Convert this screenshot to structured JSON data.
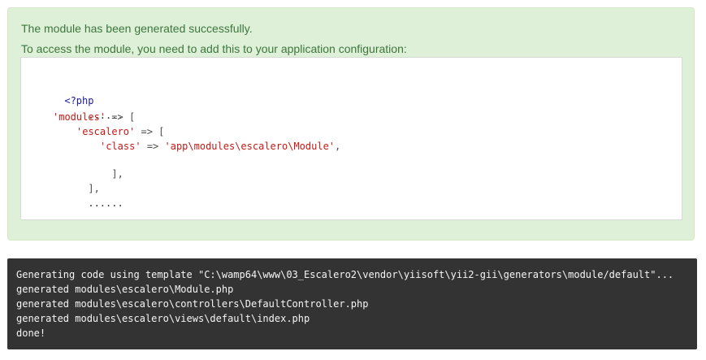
{
  "alert": {
    "message": "The module has been generated successfully.",
    "instructions": "To access the module, you need to add this to your application configuration:"
  },
  "code": {
    "open_tag": "<?php",
    "ellipsis_top": "......",
    "modules_key": "'modules'",
    "arrow": "=>",
    "open_bracket": "[",
    "module_id_key": "'escalero'",
    "class_key": "'class'",
    "class_value": "'app\\modules\\escalero\\Module'",
    "comma": ",",
    "close_inner": "],",
    "close_outer": "],",
    "ellipsis_bottom": "......"
  },
  "console": {
    "lines": [
      "Generating code using template \"C:\\wamp64\\www\\03_Escalero2\\vendor\\yiisoft\\yii2-gii\\generators\\module/default\"...",
      "generated modules\\escalero\\Module.php",
      "generated modules\\escalero\\controllers\\DefaultController.php",
      "generated modules\\escalero\\views\\default\\index.php",
      "done!"
    ]
  },
  "colors": {
    "alert_bg": "#dff0d8",
    "alert_text": "#3c763d",
    "code_string": "#c41a16",
    "code_tag": "#1b1ba8",
    "console_bg": "#333333"
  }
}
